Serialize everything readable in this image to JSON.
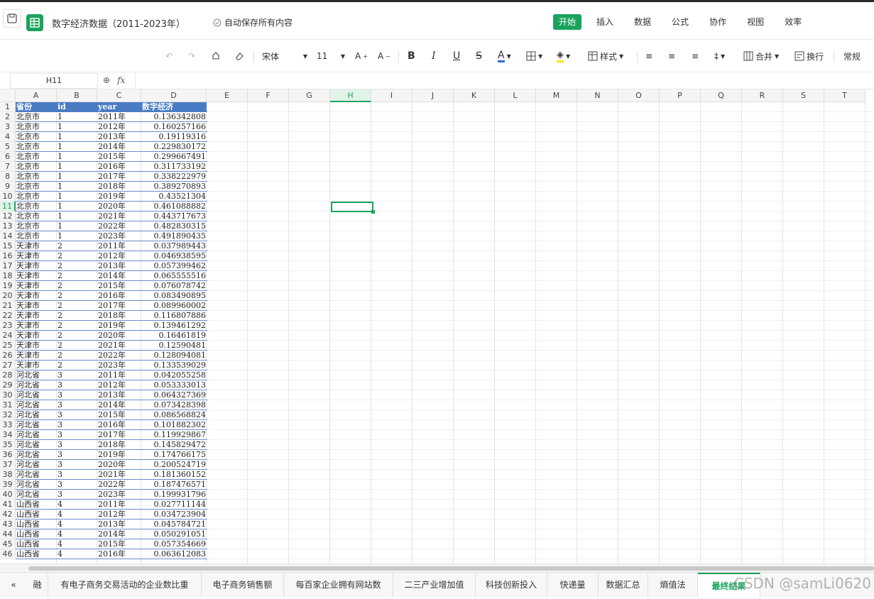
{
  "title": "数字经济数据（2011-2023年）",
  "autosave": "自动保存所有内容",
  "menu": [
    "开始",
    "插入",
    "数据",
    "公式",
    "协作",
    "视图",
    "效率"
  ],
  "toolbar": {
    "font": "宋体",
    "size": "11",
    "style": "样式",
    "merge": "合并",
    "wrap": "换行",
    "format": "常规",
    "fx": "fx"
  },
  "namebox": "H11",
  "columns": [
    "A",
    "B",
    "C",
    "D",
    "E",
    "F",
    "G",
    "H",
    "I",
    "J",
    "K",
    "L",
    "M",
    "N",
    "O",
    "P",
    "Q",
    "R",
    "S",
    "T"
  ],
  "header_row": [
    "省份",
    "id",
    "year",
    "数字经济"
  ],
  "rows": [
    [
      "北京市",
      "1",
      "2011年",
      "0.136342808"
    ],
    [
      "北京市",
      "1",
      "2012年",
      "0.160257166"
    ],
    [
      "北京市",
      "1",
      "2013年",
      "0.19119316"
    ],
    [
      "北京市",
      "1",
      "2014年",
      "0.229830172"
    ],
    [
      "北京市",
      "1",
      "2015年",
      "0.299667491"
    ],
    [
      "北京市",
      "1",
      "2016年",
      "0.311733192"
    ],
    [
      "北京市",
      "1",
      "2017年",
      "0.338222979"
    ],
    [
      "北京市",
      "1",
      "2018年",
      "0.389270893"
    ],
    [
      "北京市",
      "1",
      "2019年",
      "0.43521304"
    ],
    [
      "北京市",
      "1",
      "2020年",
      "0.461088882"
    ],
    [
      "北京市",
      "1",
      "2021年",
      "0.443717673"
    ],
    [
      "北京市",
      "1",
      "2022年",
      "0.482830315"
    ],
    [
      "北京市",
      "1",
      "2023年",
      "0.491890435"
    ],
    [
      "天津市",
      "2",
      "2011年",
      "0.037989443"
    ],
    [
      "天津市",
      "2",
      "2012年",
      "0.046938595"
    ],
    [
      "天津市",
      "2",
      "2013年",
      "0.057399462"
    ],
    [
      "天津市",
      "2",
      "2014年",
      "0.065555516"
    ],
    [
      "天津市",
      "2",
      "2015年",
      "0.076078742"
    ],
    [
      "天津市",
      "2",
      "2016年",
      "0.083490895"
    ],
    [
      "天津市",
      "2",
      "2017年",
      "0.089960002"
    ],
    [
      "天津市",
      "2",
      "2018年",
      "0.116807886"
    ],
    [
      "天津市",
      "2",
      "2019年",
      "0.139461292"
    ],
    [
      "天津市",
      "2",
      "2020年",
      "0.16461819"
    ],
    [
      "天津市",
      "2",
      "2021年",
      "0.12590481"
    ],
    [
      "天津市",
      "2",
      "2022年",
      "0.128094081"
    ],
    [
      "天津市",
      "2",
      "2023年",
      "0.133539029"
    ],
    [
      "河北省",
      "3",
      "2011年",
      "0.042055258"
    ],
    [
      "河北省",
      "3",
      "2012年",
      "0.053333013"
    ],
    [
      "河北省",
      "3",
      "2013年",
      "0.064327369"
    ],
    [
      "河北省",
      "3",
      "2014年",
      "0.073428398"
    ],
    [
      "河北省",
      "3",
      "2015年",
      "0.086568824"
    ],
    [
      "河北省",
      "3",
      "2016年",
      "0.101882302"
    ],
    [
      "河北省",
      "3",
      "2017年",
      "0.119929867"
    ],
    [
      "河北省",
      "3",
      "2018年",
      "0.145829472"
    ],
    [
      "河北省",
      "3",
      "2019年",
      "0.174766175"
    ],
    [
      "河北省",
      "3",
      "2020年",
      "0.200524719"
    ],
    [
      "河北省",
      "3",
      "2021年",
      "0.181360152"
    ],
    [
      "河北省",
      "3",
      "2022年",
      "0.187476571"
    ],
    [
      "河北省",
      "3",
      "2023年",
      "0.199931796"
    ],
    [
      "山西省",
      "4",
      "2011年",
      "0.027711144"
    ],
    [
      "山西省",
      "4",
      "2012年",
      "0.034723904"
    ],
    [
      "山西省",
      "4",
      "2013年",
      "0.045784721"
    ],
    [
      "山西省",
      "4",
      "2014年",
      "0.050291051"
    ],
    [
      "山西省",
      "4",
      "2015年",
      "0.057354669"
    ],
    [
      "山西省",
      "4",
      "2016年",
      "0.063612083"
    ]
  ],
  "sheet_tabs": [
    "融",
    "有电子商务交易活动的企业数比重",
    "电子商务销售额",
    "每百家企业拥有网站数",
    "二三产业增加值",
    "科技创新投入",
    "快递量",
    "数据汇总",
    "熵值法",
    "最终结果"
  ],
  "active_tab": "最终结果",
  "watermark": "CSDN @samLi0620",
  "accent": "#1aa35c",
  "header_fill": "#4a7cc4"
}
